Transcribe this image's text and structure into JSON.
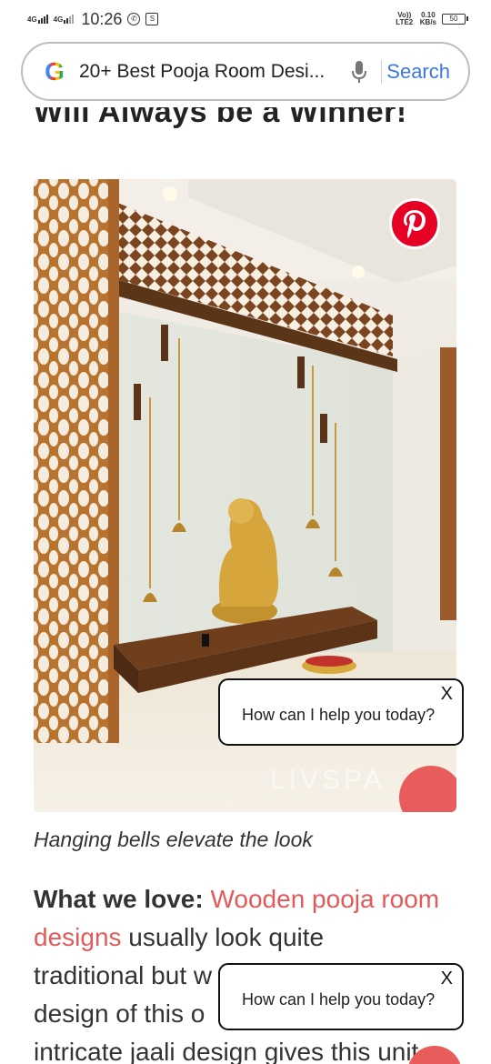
{
  "status_bar": {
    "net1": "4G",
    "net2": "4G",
    "time": "10:26",
    "volte": "Vo)) LTE2",
    "speed_value": "0.10",
    "speed_unit": "KB/s",
    "battery": "50"
  },
  "search": {
    "query": "20+ Best Pooja Room Desi...",
    "button_label": "Search"
  },
  "article": {
    "heading_partial": "Will Always be a Winner!",
    "image_watermark": "LIVSPA",
    "caption": "Hanging bells elevate the look",
    "body_label": "What we love:",
    "body_link": "Wooden pooja room designs",
    "body_line1_rest": " usually look quite",
    "body_line2": "traditional but w",
    "body_line3": "design of this o",
    "body_line4": "intricate jaali design gives this unit"
  },
  "chat_popups": [
    {
      "text": "How can I help you today?",
      "close": "X"
    },
    {
      "text": "How can I help you today?",
      "close": "X"
    }
  ],
  "colors": {
    "link": "#e25a5a",
    "pinterest": "#e60023",
    "search_button": "#3b78e7"
  }
}
